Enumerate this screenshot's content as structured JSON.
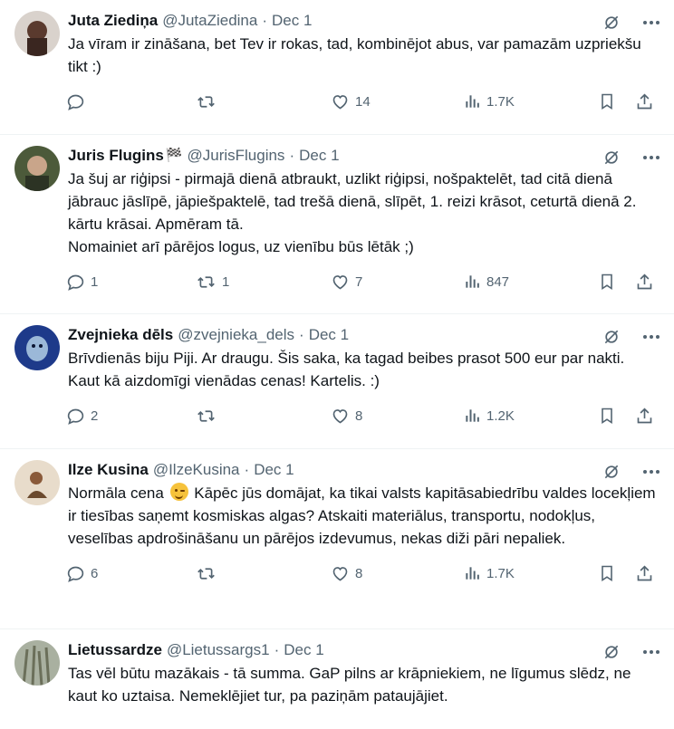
{
  "tweets": [
    {
      "name": "Juta Ziediņa",
      "flag": "",
      "handle": "@JutaZiedina",
      "date": "Dec 1",
      "text": "Ja vīram ir zināšana, bet Tev ir rokas, tad, kombinējot abus, var pamazām uzpriekšu tikt :)",
      "replies": "",
      "retweets": "",
      "likes": "14",
      "views": "1.7K",
      "avatar_colors": [
        "#d9d2cc",
        "#5a3a2e"
      ]
    },
    {
      "name": "Juris Flugins",
      "flag": "🏁",
      "handle": "@JurisFlugins",
      "date": "Dec 1",
      "text": "Ja šuj ar riģipsi - pirmajā dienā atbraukt, uzlikt riģipsi, nošpaktelēt, tad citā dienā jābrauc jāslīpē, jāpiešpaktelē, tad trešā dienā, slīpēt, 1. reizi krāsot, ceturtā dienā 2. kārtu krāsai. Apmēram tā.\nNomainiet arī pārējos logus, uz vienību būs lētāk ;)",
      "replies": "1",
      "retweets": "1",
      "likes": "7",
      "views": "847",
      "avatar_colors": [
        "#4c5a3a",
        "#c9a58a"
      ]
    },
    {
      "name": "Zvejnieka dēls",
      "flag": "",
      "handle": "@zvejnieka_dels",
      "date": "Dec 1",
      "text": "Brīvdienās biju Piji. Ar draugu. Šis saka, ka tagad beibes prasot 500 eur par nakti. Kaut kā aizdomīgi vienādas cenas! Kartelis. :)",
      "replies": "2",
      "retweets": "",
      "likes": "8",
      "views": "1.2K",
      "avatar_colors": [
        "#1e3a8a",
        "#9bb8d8"
      ]
    },
    {
      "name": "Ilze Kusina",
      "flag": "",
      "handle": "@IlzeKusina",
      "date": "Dec 1",
      "text_before": "Normāla cena ",
      "text_after": " Kāpēc jūs domājat, ka tikai valsts kapitāsabiedrību valdes locekļiem ir tiesības saņemt kosmiskas algas? Atskaiti materiālus, transportu, nodokļus, veselības apdrošināšanu un pārējos izdevumus, nekas diži pāri nepaliek.",
      "emoji": "winking-face",
      "replies": "6",
      "retweets": "",
      "likes": "8",
      "views": "1.7K",
      "avatar_colors": [
        "#e8dccb",
        "#8a5a3a"
      ]
    },
    {
      "name": "Lietussardze",
      "flag": "",
      "handle": "@Lietussargs1",
      "date": "Dec 1",
      "text": "Tas vēl būtu mazākais - tā summa. GaP pilns ar krāpniekiem, ne līgumus slēdz, ne kaut ko uztaisa. Nemeklējiet tur, pa paziņām pataujājiet.",
      "replies": "",
      "retweets": "",
      "likes": "",
      "views": "",
      "avatar_colors": [
        "#6b6f5a",
        "#a9b0a0"
      ]
    }
  ],
  "icons": {
    "grok": "grok-icon",
    "more": "more-icon",
    "reply": "reply-icon",
    "retweet": "retweet-icon",
    "like": "heart-icon",
    "views": "views-icon",
    "bookmark": "bookmark-icon",
    "share": "share-icon"
  },
  "colors": {
    "text": "#0f1419",
    "secondary": "#536471",
    "border": "#eff3f4"
  }
}
